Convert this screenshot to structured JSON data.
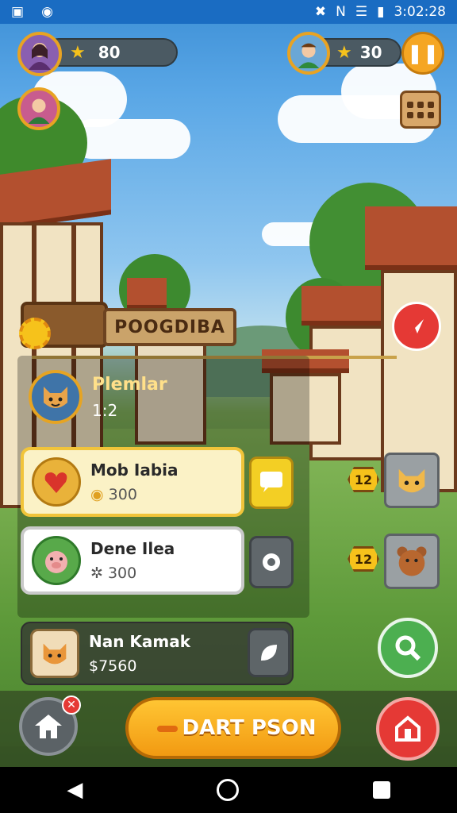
{
  "status_bar": {
    "time": "3:02:28"
  },
  "hud": {
    "player_stars": "80",
    "opponent_stars": "30"
  },
  "title_sign": "POOGDIBA",
  "player": {
    "name": "Plemlar",
    "level": "1:2"
  },
  "cards": [
    {
      "name": "Mob Iabia",
      "value": "300"
    },
    {
      "name": "Dene Ilea",
      "value": "300"
    },
    {
      "name": "Nan Kamak",
      "value": "7560"
    }
  ],
  "badges": [
    "12",
    "12"
  ],
  "bottom": {
    "main_button": "DART PSON"
  },
  "colors": {
    "accent_orange": "#f5a623",
    "action_green": "#4caf50",
    "action_red": "#e53935",
    "card_yellow": "#fbf2c6"
  },
  "icons": [
    "star-icon",
    "pause-icon",
    "menu-grid-icon",
    "chat-icon",
    "location-icon",
    "home-icon",
    "search-icon",
    "shop-icon",
    "back-icon"
  ]
}
